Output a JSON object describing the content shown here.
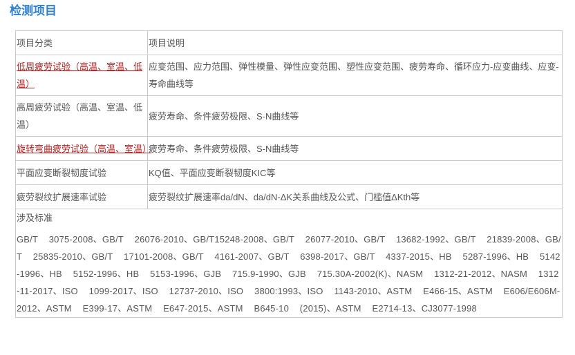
{
  "section_title": "检测项目",
  "table": {
    "header": {
      "col1": "项目分类",
      "col2": "项目说明"
    },
    "rows": [
      {
        "category": "低周疲劳试验（高温、室温、低温）",
        "description": "应变范围、应力范围、弹性模量、弹性应变范围、塑性应变范围、疲劳寿命、循环应力-应变曲线、应变-寿命曲线等"
      },
      {
        "category": "高周疲劳试验（高温、室温、低温）",
        "description": "疲劳寿命、条件疲劳极限、S-N曲线等"
      },
      {
        "category": "旋转弯曲疲劳试验（高温、室温）",
        "description": "疲劳寿命、条件疲劳极限、S-N曲线等"
      },
      {
        "category": "平面应变断裂韧度试验",
        "description": "KQ值、平面应变断裂韧度KIC等"
      },
      {
        "category": "疲劳裂纹扩展速率试验",
        "description": "疲劳裂纹扩展速率da/dN、da/dN-ΔK关系曲线及公式、门槛值ΔKth等"
      }
    ],
    "standards_label": "涉及标准",
    "standards_text": "GB/T 3075-2008、GB/T 26076-2010、GB/T15248-2008、GB/T 26077-2010、GB/T 13682-1992、GB/T 21839-2008、GB/T 25835-2010、GB/T 17101-2008、GB/T 4161-2007、GB/T 6398-2017、GB/T 4337-2015、HB 5287-1996、HB 5142-1996、HB 5152-1996、HB 5153-1996、GJB 715.9-1990、GJB 715.30A-2002(K)、NASM 1312-21-2012、NASM 1312-11-2017、ISO 1099-2017、ISO 12737-2010、ISO 3800:1993、ISO 1143-2010、ASTM E466-15、ASTM E606/E606M-2012、ASTM E399-17、ASTM E647-2015、ASTM B645-10 (2015)、ASTM E2714-13、CJ3077-1998"
  }
}
